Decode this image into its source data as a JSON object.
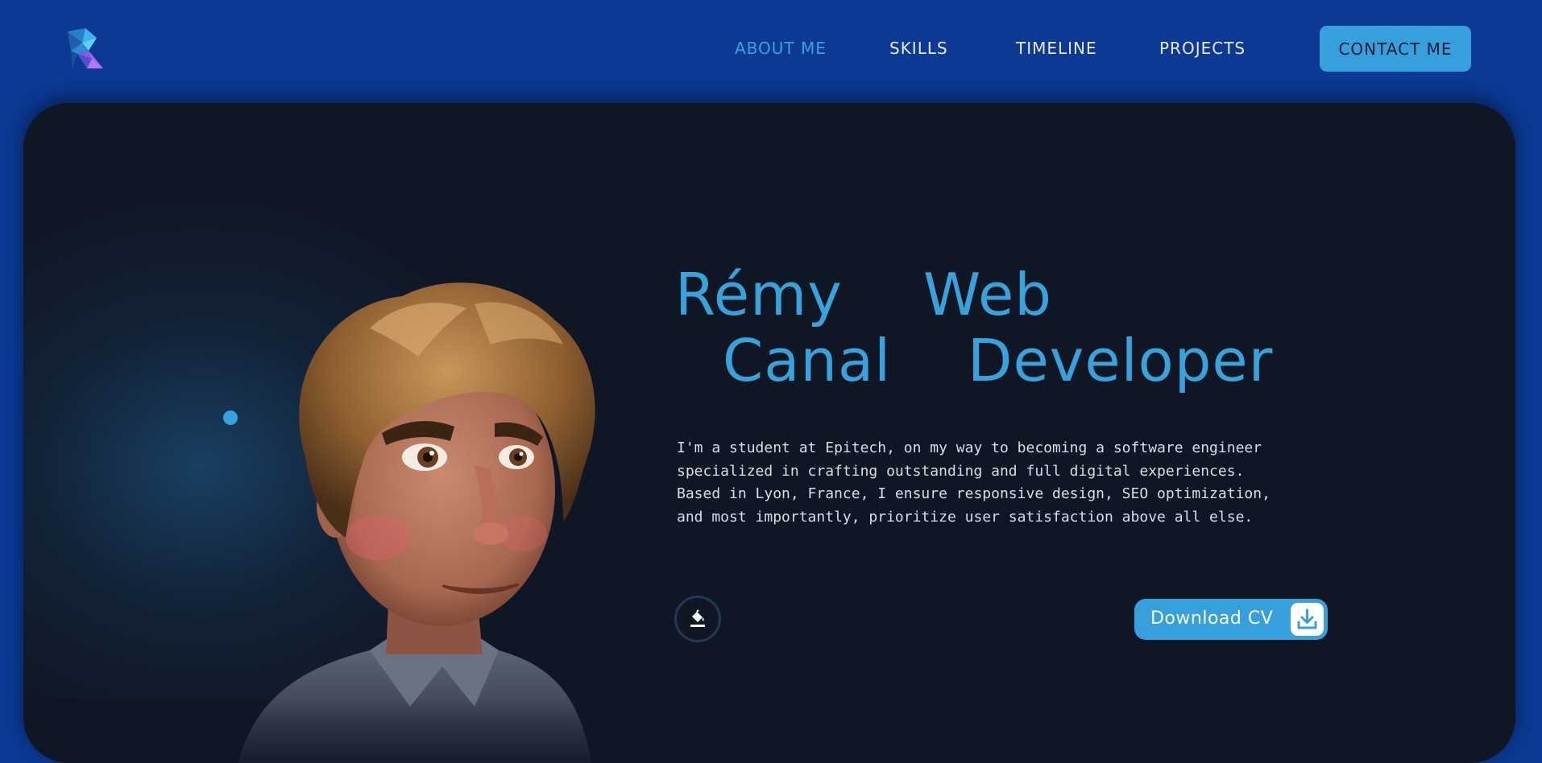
{
  "header": {
    "logo_icon": "polygon-r-logo-icon",
    "nav": [
      {
        "label": "ABOUT ME",
        "active": true
      },
      {
        "label": "SKILLS",
        "active": false
      },
      {
        "label": "TIMELINE",
        "active": false
      },
      {
        "label": "PROJECTS",
        "active": false
      }
    ],
    "contact_label": "CONTACT ME"
  },
  "hero": {
    "first_name": "Rémy",
    "last_name": "Canal",
    "role_line1": "Web",
    "role_line2": "Developer",
    "bio": "I'm a student at Epitech, on my way to becoming a software engineer\nspecialized in crafting outstanding and full digital experiences.\nBased in Lyon, France, I ensure responsive design, SEO optimization,\nand most importantly, prioritize user satisfaction above all else.",
    "theme_icon": "paint-bucket-icon",
    "download_label": "Download CV",
    "download_icon": "download-icon"
  },
  "colors": {
    "brand_blue": "#0b3993",
    "accent": "#37a2dc",
    "card_bg": "#101724",
    "text_light": "#d8dde6"
  }
}
